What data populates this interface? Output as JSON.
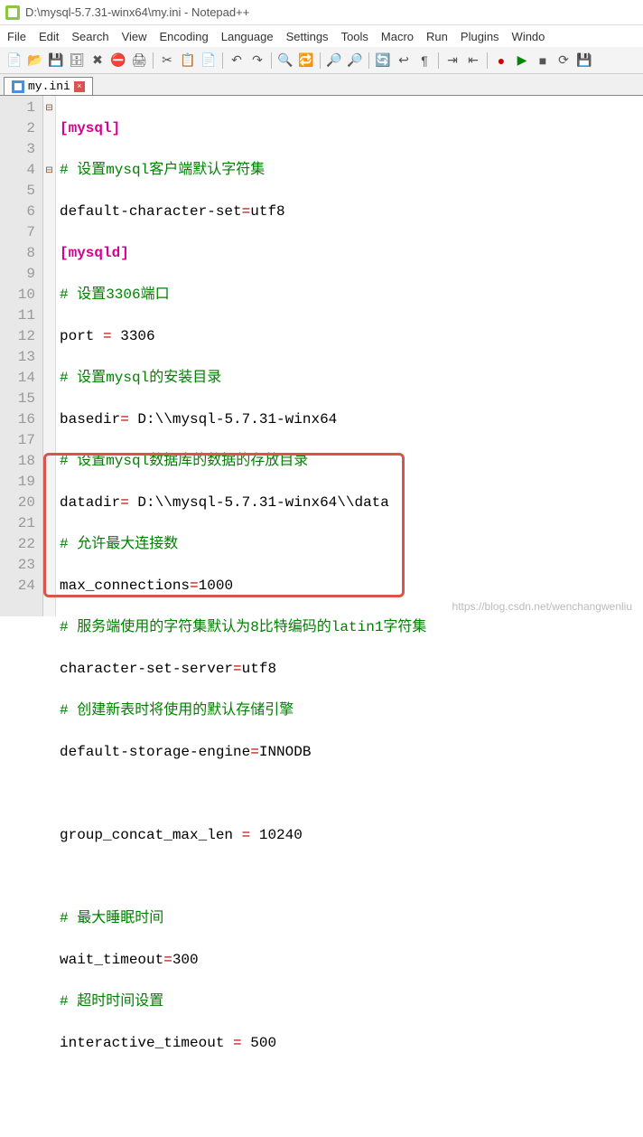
{
  "titlebar": {
    "path": "D:\\mysql-5.7.31-winx64\\my.ini - Notepad++"
  },
  "menu": {
    "file": "File",
    "edit": "Edit",
    "search": "Search",
    "view": "View",
    "encoding": "Encoding",
    "language": "Language",
    "settings": "Settings",
    "tools": "Tools",
    "macro": "Macro",
    "run": "Run",
    "plugins": "Plugins",
    "window": "Windo"
  },
  "tab": {
    "label": "my.ini",
    "close": "×"
  },
  "gutter": [
    "1",
    "2",
    "3",
    "4",
    "5",
    "6",
    "7",
    "8",
    "9",
    "10",
    "11",
    "12",
    "13",
    "14",
    "15",
    "16",
    "17",
    "18",
    "19",
    "20",
    "21",
    "22",
    "23",
    "24"
  ],
  "code": {
    "l1": {
      "sec": "[mysql]"
    },
    "l2": {
      "cmt": "# 设置mysql客户端默认字符集"
    },
    "l3": {
      "k": "default-character-set",
      "eq": "=",
      "v": "utf8"
    },
    "l4": {
      "sec": "[mysqld]"
    },
    "l5": {
      "cmt": "# 设置3306端口"
    },
    "l6": {
      "k": "port ",
      "eq": "=",
      "v": " 3306"
    },
    "l7": {
      "cmt": "# 设置mysql的安装目录"
    },
    "l8": {
      "k": "basedir",
      "eq": "=",
      "v": " D:\\\\mysql-5.7.31-winx64"
    },
    "l9": {
      "cmt": "# 设置mysql数据库的数据的存放目录"
    },
    "l10": {
      "k": "datadir",
      "eq": "=",
      "v": " D:\\\\mysql-5.7.31-winx64\\\\data"
    },
    "l11": {
      "cmt": "# 允许最大连接数"
    },
    "l12": {
      "k": "max_connections",
      "eq": "=",
      "v": "1000"
    },
    "l13": {
      "cmt": "# 服务端使用的字符集默认为8比特编码的latin1字符集"
    },
    "l14": {
      "k": "character-set-server",
      "eq": "=",
      "v": "utf8"
    },
    "l15": {
      "cmt": "# 创建新表时将使用的默认存储引擎"
    },
    "l16": {
      "k": "default-storage-engine",
      "eq": "=",
      "v": "INNODB"
    },
    "l17": {
      "blank": " "
    },
    "l18": {
      "k": "group_concat_max_len ",
      "eq": "=",
      "v": " 10240"
    },
    "l19": {
      "blank": " "
    },
    "l20": {
      "cmt": "# 最大睡眠时间"
    },
    "l21": {
      "k": "wait_timeout",
      "eq": "=",
      "v": "300"
    },
    "l22": {
      "cmt": "# 超时时间设置"
    },
    "l23": {
      "k": "interactive_timeout ",
      "eq": "=",
      "v": " 500"
    },
    "l24": {
      "blank": " "
    }
  },
  "watermark": "https://blog.csdn.net/wenchangwenliu"
}
